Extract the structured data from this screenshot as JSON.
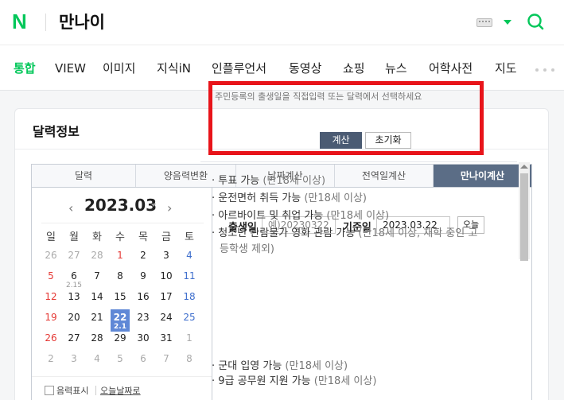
{
  "header": {
    "logo": "N",
    "query": "만나이",
    "icons": [
      "keyboard-icon",
      "dropdown-caret-icon",
      "search-icon"
    ],
    "accent_color": "#03c75a"
  },
  "tabs": [
    "통합",
    "VIEW",
    "이미지",
    "지식iN",
    "인플루언서",
    "동영상",
    "쇼핑",
    "뉴스",
    "어학사전",
    "지도"
  ],
  "active_tab": "통합",
  "card": {
    "title": "달력정보",
    "calc_tabs": [
      "달력",
      "양음력변환",
      "날짜계산",
      "전역일계산",
      "만나이계산"
    ],
    "active_calc_tab": "만나이계산"
  },
  "calendar": {
    "prev": "‹",
    "next": "›",
    "month": "2023.03",
    "weekdays": [
      "일",
      "월",
      "화",
      "수",
      "목",
      "금",
      "토"
    ],
    "rows": [
      [
        {
          "d": "26",
          "t": "other"
        },
        {
          "d": "27",
          "t": "other"
        },
        {
          "d": "28",
          "t": "other"
        },
        {
          "d": "1",
          "t": "holiday"
        },
        {
          "d": "2",
          "t": ""
        },
        {
          "d": "3",
          "t": ""
        },
        {
          "d": "4",
          "t": "sat"
        }
      ],
      [
        {
          "d": "5",
          "t": "sun"
        },
        {
          "d": "6",
          "t": "",
          "l": "2.15"
        },
        {
          "d": "7",
          "t": ""
        },
        {
          "d": "8",
          "t": ""
        },
        {
          "d": "9",
          "t": ""
        },
        {
          "d": "10",
          "t": ""
        },
        {
          "d": "11",
          "t": "sat"
        }
      ],
      [
        {
          "d": "12",
          "t": "sun"
        },
        {
          "d": "13",
          "t": ""
        },
        {
          "d": "14",
          "t": ""
        },
        {
          "d": "15",
          "t": ""
        },
        {
          "d": "16",
          "t": ""
        },
        {
          "d": "17",
          "t": ""
        },
        {
          "d": "18",
          "t": "sat"
        }
      ],
      [
        {
          "d": "19",
          "t": "sun"
        },
        {
          "d": "20",
          "t": ""
        },
        {
          "d": "21",
          "t": ""
        },
        {
          "d": "22",
          "t": "selected",
          "l": "2.1"
        },
        {
          "d": "23",
          "t": ""
        },
        {
          "d": "24",
          "t": ""
        },
        {
          "d": "25",
          "t": "sat"
        }
      ],
      [
        {
          "d": "26",
          "t": "sun"
        },
        {
          "d": "27",
          "t": ""
        },
        {
          "d": "28",
          "t": ""
        },
        {
          "d": "29",
          "t": ""
        },
        {
          "d": "30",
          "t": ""
        },
        {
          "d": "31",
          "t": ""
        },
        {
          "d": "1",
          "t": "other"
        }
      ],
      [
        {
          "d": "2",
          "t": "other"
        },
        {
          "d": "3",
          "t": "other"
        },
        {
          "d": "4",
          "t": "other"
        },
        {
          "d": "5",
          "t": "other"
        },
        {
          "d": "6",
          "t": "other"
        },
        {
          "d": "7",
          "t": "other"
        },
        {
          "d": "8",
          "t": "other"
        }
      ]
    ],
    "lunar_toggle_label": "음력표시",
    "today_link": "오늘날짜로"
  },
  "form": {
    "hint": "주민등록의 출생일을 직접입력 또는 달력에서 선택하세요",
    "birth_label": "출생일",
    "birth_placeholder": "예)20230322",
    "base_label": "기준일",
    "base_value": "2023.03.22",
    "today_button": "오늘",
    "calc_button": "계산",
    "reset_button": "초기화"
  },
  "results": [
    {
      "text": "투표 가능",
      "cond": " (만18세 이상)"
    },
    {
      "text": "운전면허 취득 가능",
      "cond": " (만18세 이상)"
    },
    {
      "text": "아르바이트 및 취업 가능",
      "cond": " (만18세 이상)"
    },
    {
      "text": "청소년 관람불가 영화 관람 가능",
      "cond": " (만18세 이상, 재학 중인 고"
    },
    {
      "text": "군대 입영 가능",
      "cond": " (만18세 이상)"
    },
    {
      "text": "9급 공무원 지원 가능",
      "cond": " (만18세 이상)"
    }
  ],
  "results_cont": "등학생 제외)",
  "colors": {
    "highlight_box": "#e8141a",
    "calc_tab_active": "#5b6d86",
    "selected_day": "#5f88d6"
  }
}
